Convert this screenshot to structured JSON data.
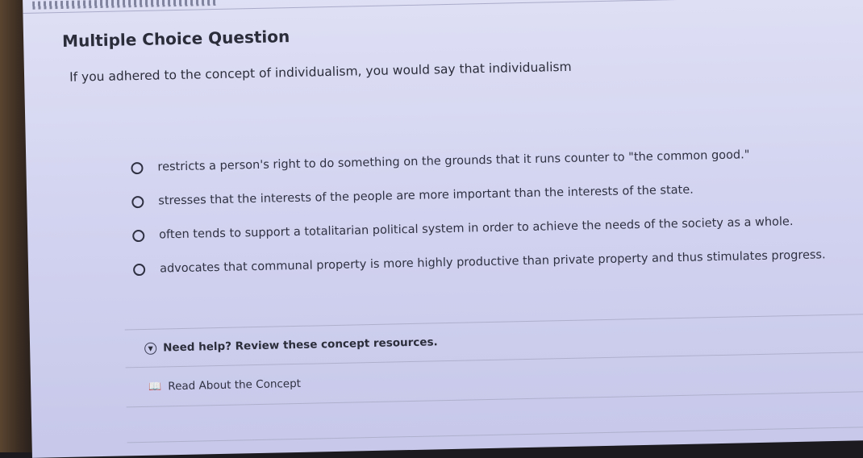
{
  "question": {
    "type_label": "Multiple Choice Question",
    "prompt": "If you adhered to the concept of individualism, you would say that individualism"
  },
  "options": [
    "restricts a person's right to do something on the grounds that it runs counter to \"the common good.\"",
    "stresses that the interests of the people are more important than the interests of the state.",
    "often tends to support a totalitarian political system in order to achieve the needs of the society as a whole.",
    "advocates that communal property is more highly productive than private property and thus stimulates progress."
  ],
  "help": {
    "toggle_label": "Need help? Review these concept resources.",
    "toggle_icon": "chevron-down-circle-icon",
    "resource_label": "Read About the Concept",
    "resource_icon": "book-icon"
  }
}
